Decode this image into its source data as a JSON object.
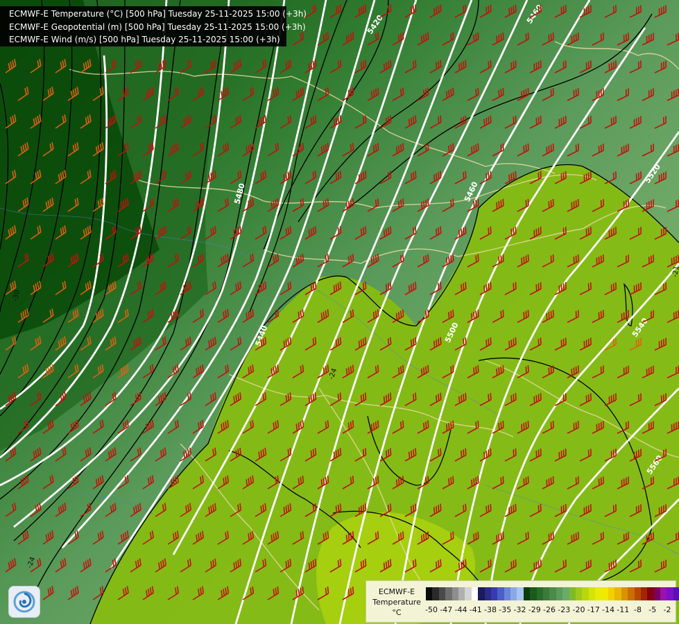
{
  "header": {
    "lines": [
      "ECMWF-E Temperature (°C) [500 hPa] Tuesday 25-11-2025 15:00 (+3h)",
      "ECMWF-E Geopotential (m) [500 hPa] Tuesday 25-11-2025 15:00 (+3h)",
      "ECMWF-E Wind (m/s) [500 hPa] Tuesday 25-11-2025 15:00 (+3h)"
    ]
  },
  "geopotential_labels": [
    "5420",
    "5460",
    "5480",
    "5460",
    "5520",
    "5440",
    "5500",
    "5540",
    "5560"
  ],
  "temperature_labels": [
    "-30",
    "-24",
    "-24",
    "-21"
  ],
  "legend": {
    "title": "ECMWF-E",
    "subtitle": "Temperature",
    "unit": "°C",
    "ticks": [
      "-50",
      "-47",
      "-44",
      "-41",
      "-38",
      "-35",
      "-32",
      "-29",
      "-26",
      "-23",
      "-20",
      "-17",
      "-14",
      "-11",
      "-8",
      "-5",
      "-2"
    ],
    "colors": [
      "#0a0a0a",
      "#2a2a2a",
      "#4a4a4a",
      "#6e6e6e",
      "#8e8e8e",
      "#b0b0b0",
      "#d4d4d4",
      "#ffffff",
      "#1a1a5c",
      "#2b2b8a",
      "#3a3ab0",
      "#4a5fc8",
      "#6a86d8",
      "#8aa8e6",
      "#a8c4f0",
      "#0b3d0b",
      "#1a5a1a",
      "#2a6b2a",
      "#3a7b3a",
      "#4a8b4a",
      "#5a9b5a",
      "#6aab6a",
      "#7dba2a",
      "#9bca1a",
      "#b8d80c",
      "#d4e40a",
      "#e8ec08",
      "#f2e800",
      "#f2d000",
      "#e8b800",
      "#d89400",
      "#c87000",
      "#b84a00",
      "#a02800",
      "#880010",
      "#7a0060",
      "#9a10b0",
      "#7a10c8",
      "#5a10b0",
      "#3a0a90"
    ]
  },
  "colors": {
    "wind_barb": "#c0120c",
    "wind_barb_strong": "#e06010",
    "geopotential_contour": "#ffffff",
    "temperature_contour": "#000000",
    "borders": "#e8d8a0"
  }
}
